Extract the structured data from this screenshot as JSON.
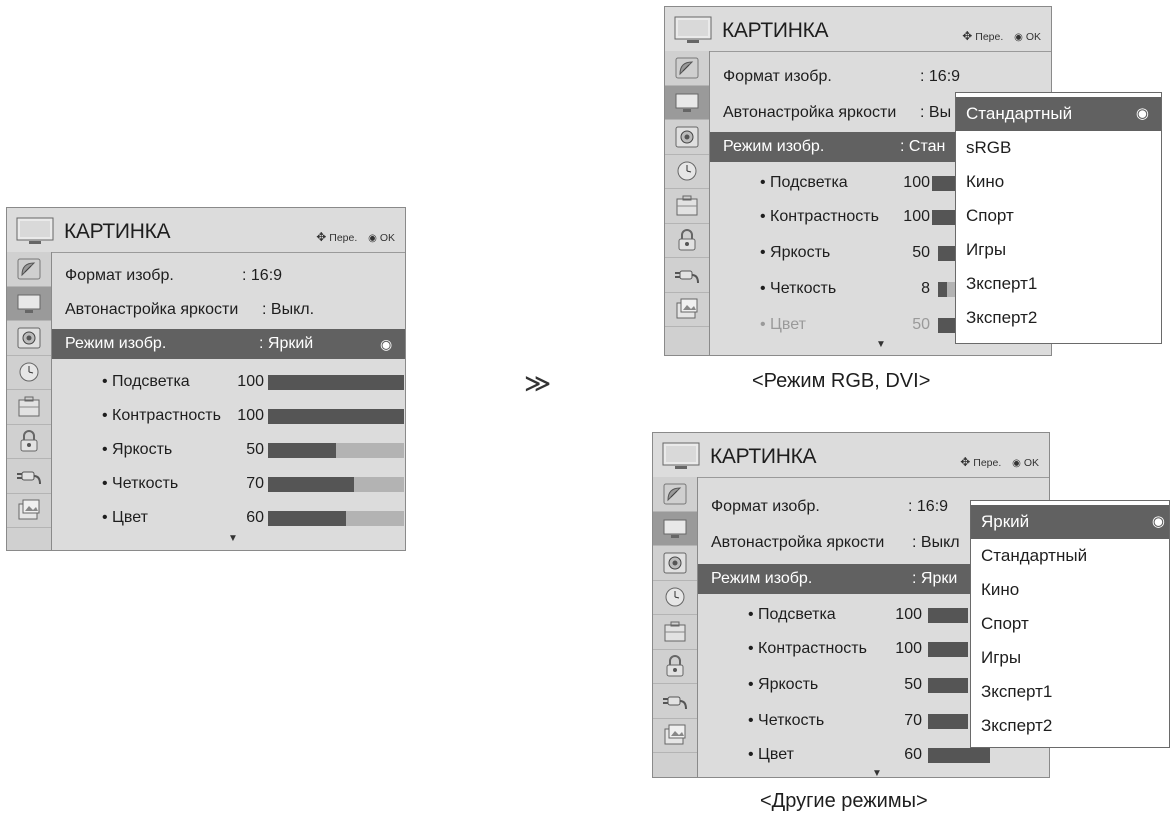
{
  "menu_title": "КАРТИНКА",
  "hint": {
    "move_icon": "four-way-arrow-icon",
    "move_label": "Пере.",
    "ok_icon": "radio-dot-icon",
    "ok_label": "OK"
  },
  "sidebar_icons": [
    "satellite-dish-icon",
    "tv-screen-icon",
    "speaker-icon",
    "clock-icon",
    "briefcase-icon",
    "padlock-icon",
    "cable-plug-icon",
    "photo-slideshow-icon"
  ],
  "labels": {
    "aspect": "Формат изобр.",
    "auto_brightness": "Автонастройка яркости",
    "picture_mode": "Режим изобр.",
    "backlight": "• Подсветка",
    "contrast": "• Контрастность",
    "brightness": "• Яркость",
    "sharpness": "• Четкость",
    "color": "• Цвет"
  },
  "left": {
    "aspect_value": ": 16:9",
    "auto_brightness_value": ": Выкл.",
    "picture_mode_value": ": Яркий",
    "backlight": "100",
    "backlight_level": 1.0,
    "contrast": "100",
    "contrast_level": 1.0,
    "brightness": "50",
    "brightness_level": 0.5,
    "sharpness": "70",
    "sharpness_level": 0.63,
    "color": "60",
    "color_level": 0.57
  },
  "rgb": {
    "aspect_value": ": 16:9",
    "auto_brightness_value": ": Вы",
    "picture_mode_value": ": Стан",
    "backlight": "100",
    "contrast": "100",
    "brightness": "50",
    "sharpness": "8",
    "color": "50",
    "popup": [
      "Стандартный",
      "sRGB",
      "Кино",
      "Спорт",
      "Игры",
      "Зксперт1",
      "Зксперт2"
    ],
    "caption": "<Режим RGB, DVI>"
  },
  "other": {
    "aspect_value": ": 16:9",
    "auto_brightness_value": ": Выкл",
    "picture_mode_value": ": Ярки",
    "backlight": "100",
    "contrast": "100",
    "brightness": "50",
    "sharpness": "70",
    "color": "60",
    "popup": [
      "Яркий",
      "Стандартный",
      "Кино",
      "Спорт",
      "Игры",
      "Зксперт1",
      "Зксперт2"
    ],
    "caption": "<Другие режимы>"
  },
  "step_arrow": "≫"
}
